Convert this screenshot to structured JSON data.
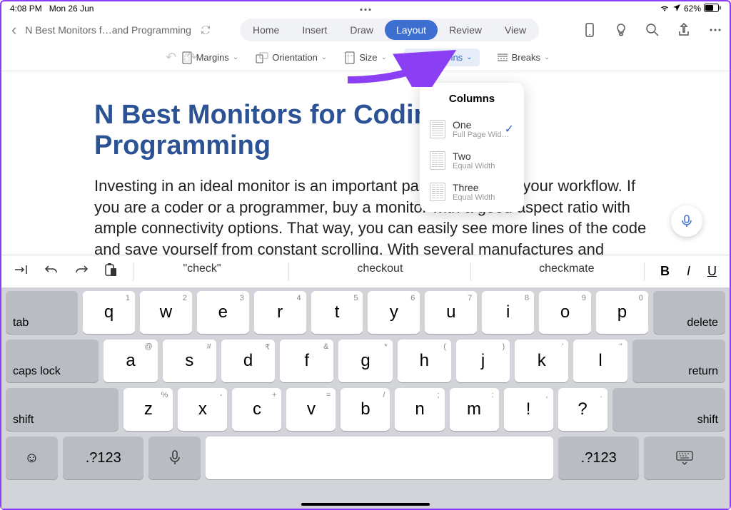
{
  "status": {
    "time": "4:08 PM",
    "date": "Mon 26 Jun",
    "battery": "62%"
  },
  "doc_title": "N Best Monitors f…and Programming",
  "tabs": {
    "home": "Home",
    "insert": "Insert",
    "draw": "Draw",
    "layout": "Layout",
    "review": "Review",
    "view": "View"
  },
  "ribbon": {
    "margins": "Margins",
    "orientation": "Orientation",
    "size": "Size",
    "columns": "Columns",
    "breaks": "Breaks"
  },
  "popover": {
    "title": "Columns",
    "items": [
      {
        "name": "One",
        "sub": "Full Page Wid…",
        "selected": true
      },
      {
        "name": "Two",
        "sub": "Equal Width",
        "selected": false
      },
      {
        "name": "Three",
        "sub": "Equal Width",
        "selected": false
      }
    ]
  },
  "document": {
    "heading": "N Best Monitors for Coding and Programming",
    "body": "Investing in an ideal monitor is an important part of improving your workflow. If you are a coder or a programmer, buy a monitor with a good aspect ratio with ample connectivity options. That way, you can easily see more lines of the code and save yourself from constant scrolling. With several manufactures and"
  },
  "keyboard": {
    "suggestions": [
      "\"check\"",
      "checkout",
      "checkmate"
    ],
    "format": {
      "bold": "B",
      "italic": "I",
      "underline": "U"
    },
    "row1": [
      {
        "k": "q",
        "a": "1"
      },
      {
        "k": "w",
        "a": "2"
      },
      {
        "k": "e",
        "a": "3"
      },
      {
        "k": "r",
        "a": "4"
      },
      {
        "k": "t",
        "a": "5"
      },
      {
        "k": "y",
        "a": "6"
      },
      {
        "k": "u",
        "a": "7"
      },
      {
        "k": "i",
        "a": "8"
      },
      {
        "k": "o",
        "a": "9"
      },
      {
        "k": "p",
        "a": "0"
      }
    ],
    "row2": [
      {
        "k": "a",
        "a": "@"
      },
      {
        "k": "s",
        "a": "#"
      },
      {
        "k": "d",
        "a": "₹"
      },
      {
        "k": "f",
        "a": "&"
      },
      {
        "k": "g",
        "a": "*"
      },
      {
        "k": "h",
        "a": "("
      },
      {
        "k": "j",
        "a": ")"
      },
      {
        "k": "k",
        "a": "'"
      },
      {
        "k": "l",
        "a": "\""
      }
    ],
    "row3": [
      {
        "k": "z",
        "a": "%"
      },
      {
        "k": "x",
        "a": "-"
      },
      {
        "k": "c",
        "a": "+"
      },
      {
        "k": "v",
        "a": "="
      },
      {
        "k": "b",
        "a": "/"
      },
      {
        "k": "n",
        "a": ";"
      },
      {
        "k": "m",
        "a": ":"
      },
      {
        "k": "!",
        "a": ","
      },
      {
        "k": "?",
        "a": "."
      }
    ],
    "labels": {
      "tab": "tab",
      "delete": "delete",
      "caps": "caps lock",
      "return": "return",
      "shift": "shift",
      "numsym": ".?123"
    }
  }
}
